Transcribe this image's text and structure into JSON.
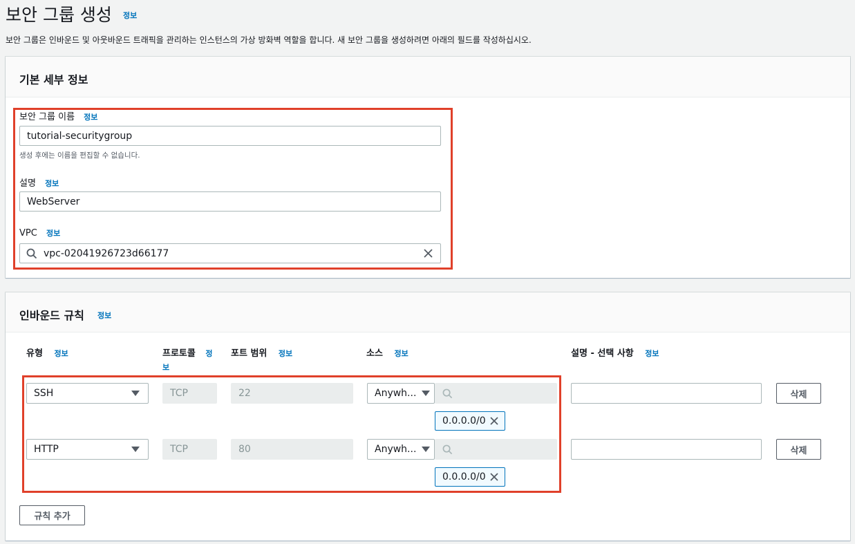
{
  "page": {
    "title": "보안 그룹 생성",
    "title_info": "정보",
    "description": "보안 그룹은 인바운드 및 아웃바운드 트래픽을 관리하는 인스턴스의 가상 방화벽 역할을 합니다. 새 보안 그룹을 생성하려면 아래의 필드를 작성하십시오."
  },
  "basic": {
    "title": "기본 세부 정보",
    "name_label": "보안 그룹 이름",
    "name_info": "정보",
    "name_value": "tutorial-securitygroup",
    "name_hint": "생성 후에는 이름을 편집할 수 없습니다.",
    "desc_label": "설명",
    "desc_info": "정보",
    "desc_value": "WebServer",
    "vpc_label": "VPC",
    "vpc_info": "정보",
    "vpc_value": "vpc-02041926723d66177"
  },
  "inbound": {
    "title": "인바운드 규칙",
    "title_info": "정보",
    "columns": {
      "type": "유형",
      "protocol_a": "프로토콜",
      "protocol_b": "보",
      "protocol_info": "정",
      "port": "포트 범위",
      "source": "소스",
      "desc": "설명 - 선택 사항",
      "info": "정보"
    },
    "rules": [
      {
        "type": "SSH",
        "protocol": "TCP",
        "port": "22",
        "source": "Anywh...",
        "cidr": "0.0.0.0/0",
        "delete": "삭제"
      },
      {
        "type": "HTTP",
        "protocol": "TCP",
        "port": "80",
        "source": "Anywh...",
        "cidr": "0.0.0.0/0",
        "delete": "삭제"
      }
    ],
    "add_rule": "규칙 추가"
  }
}
